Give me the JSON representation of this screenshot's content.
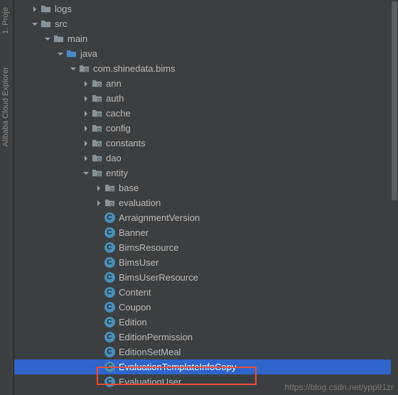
{
  "sidebar": {
    "proj_tab": "1: Proje",
    "cloud_tab": "Alibaba Cloud Explorer"
  },
  "tree": [
    {
      "indent": 18,
      "arrow": "right",
      "icon": "folder",
      "label": "logs"
    },
    {
      "indent": 18,
      "arrow": "down",
      "icon": "folder",
      "label": "src"
    },
    {
      "indent": 36,
      "arrow": "down",
      "icon": "folder",
      "label": "main"
    },
    {
      "indent": 54,
      "arrow": "down",
      "icon": "folder-blue",
      "label": "java"
    },
    {
      "indent": 72,
      "arrow": "down",
      "icon": "package",
      "label": "com.shinedata.bims"
    },
    {
      "indent": 90,
      "arrow": "right",
      "icon": "package",
      "label": "ann"
    },
    {
      "indent": 90,
      "arrow": "right",
      "icon": "package",
      "label": "auth"
    },
    {
      "indent": 90,
      "arrow": "right",
      "icon": "package",
      "label": "cache"
    },
    {
      "indent": 90,
      "arrow": "right",
      "icon": "package",
      "label": "config"
    },
    {
      "indent": 90,
      "arrow": "right",
      "icon": "package",
      "label": "constants"
    },
    {
      "indent": 90,
      "arrow": "right",
      "icon": "package",
      "label": "dao"
    },
    {
      "indent": 90,
      "arrow": "down",
      "icon": "package",
      "label": "entity"
    },
    {
      "indent": 108,
      "arrow": "right",
      "icon": "package",
      "label": "base"
    },
    {
      "indent": 108,
      "arrow": "right",
      "icon": "package",
      "label": "evaluation"
    },
    {
      "indent": 108,
      "arrow": "none",
      "icon": "class",
      "label": "ArraignmentVersion"
    },
    {
      "indent": 108,
      "arrow": "none",
      "icon": "class",
      "label": "Banner"
    },
    {
      "indent": 108,
      "arrow": "none",
      "icon": "class",
      "label": "BimsResource"
    },
    {
      "indent": 108,
      "arrow": "none",
      "icon": "class",
      "label": "BimsUser"
    },
    {
      "indent": 108,
      "arrow": "none",
      "icon": "class",
      "label": "BimsUserResource"
    },
    {
      "indent": 108,
      "arrow": "none",
      "icon": "class",
      "label": "Content"
    },
    {
      "indent": 108,
      "arrow": "none",
      "icon": "class",
      "label": "Coupon"
    },
    {
      "indent": 108,
      "arrow": "none",
      "icon": "class",
      "label": "Edition"
    },
    {
      "indent": 108,
      "arrow": "none",
      "icon": "class",
      "label": "EditionPermission"
    },
    {
      "indent": 108,
      "arrow": "none",
      "icon": "class",
      "label": "EditionSetMeal"
    },
    {
      "indent": 108,
      "arrow": "none",
      "icon": "class",
      "label": "EvaluationTemplateInfoCopy",
      "selected": true
    },
    {
      "indent": 108,
      "arrow": "none",
      "icon": "class",
      "label": "EvaluationUser"
    }
  ],
  "watermark": "https://blog.csdn.net/ypp91zr"
}
